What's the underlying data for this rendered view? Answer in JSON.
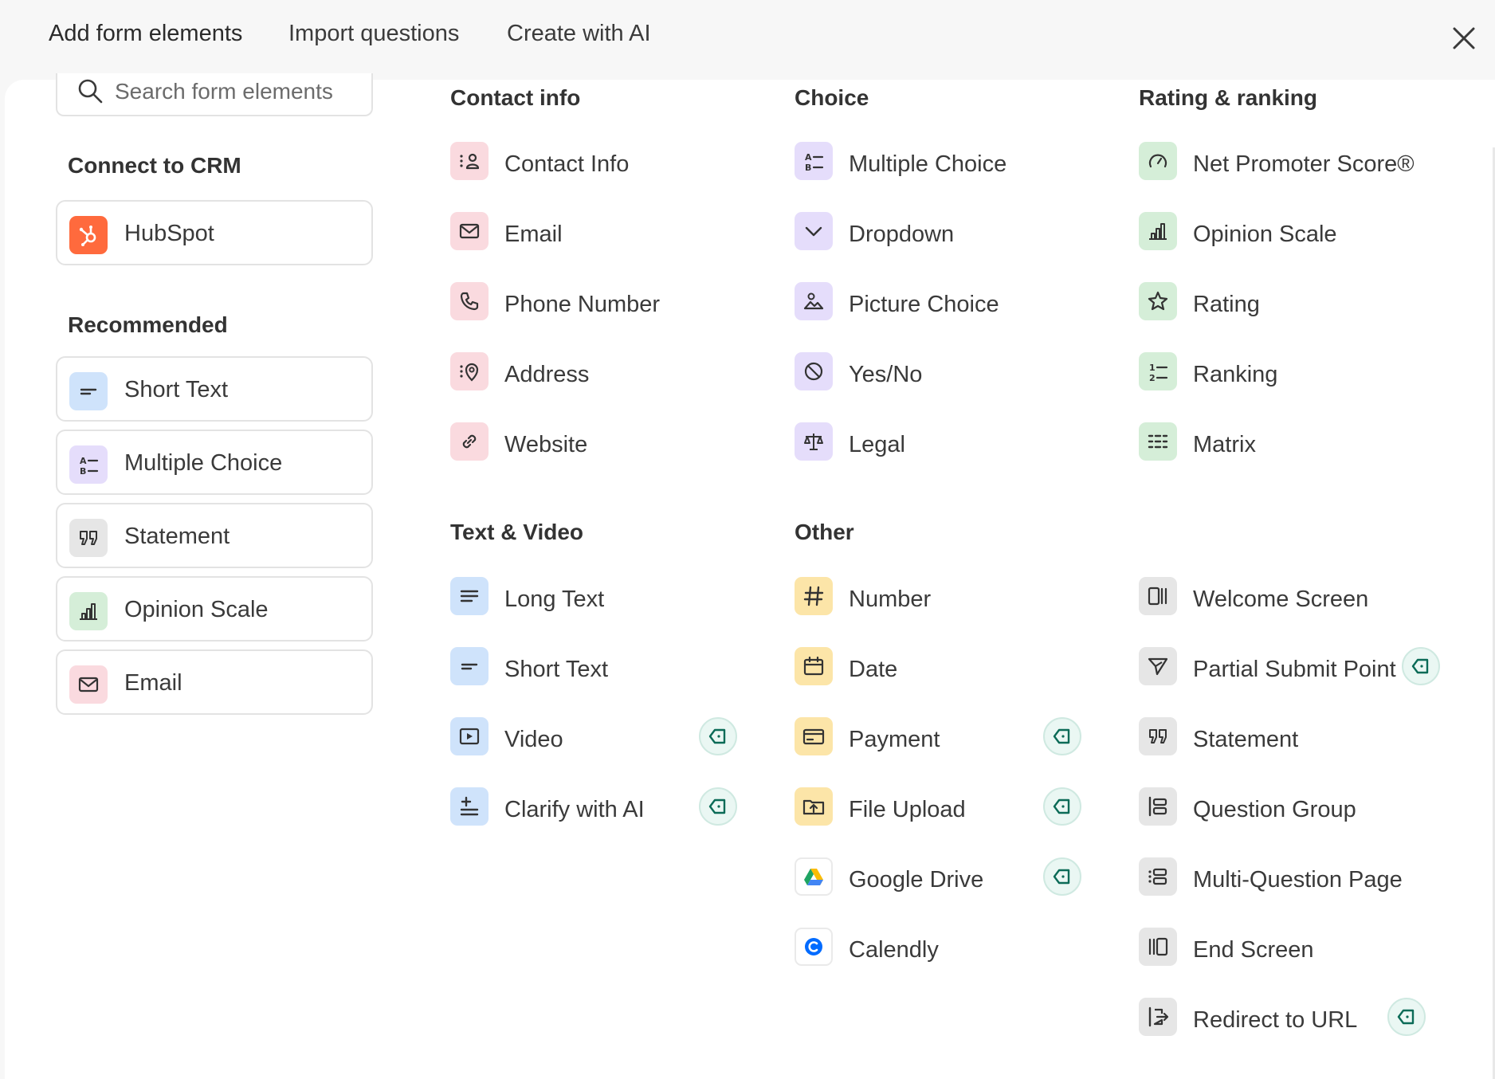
{
  "tabs": [
    {
      "label": "Add form elements"
    },
    {
      "label": "Import questions"
    },
    {
      "label": "Create with AI"
    }
  ],
  "search": {
    "placeholder": "Search form elements"
  },
  "sidebar": {
    "crm_title": "Connect to CRM",
    "crm_items": [
      {
        "label": "HubSpot",
        "icon": "hubspot-icon"
      }
    ],
    "recommended_title": "Recommended",
    "recommended_items": [
      {
        "label": "Short Text",
        "icon": "short-text-icon"
      },
      {
        "label": "Multiple Choice",
        "icon": "multiple-choice-icon"
      },
      {
        "label": "Statement",
        "icon": "quote-icon"
      },
      {
        "label": "Opinion Scale",
        "icon": "bar-chart-icon"
      },
      {
        "label": "Email",
        "icon": "envelope-icon"
      }
    ]
  },
  "sections": {
    "contact": {
      "title": "Contact info",
      "items": [
        {
          "label": "Contact Info"
        },
        {
          "label": "Email"
        },
        {
          "label": "Phone Number"
        },
        {
          "label": "Address"
        },
        {
          "label": "Website"
        }
      ]
    },
    "choice": {
      "title": "Choice",
      "items": [
        {
          "label": "Multiple Choice"
        },
        {
          "label": "Dropdown"
        },
        {
          "label": "Picture Choice"
        },
        {
          "label": "Yes/No"
        },
        {
          "label": "Legal"
        }
      ]
    },
    "rating": {
      "title": "Rating & ranking",
      "items": [
        {
          "label": "Net Promoter Score®"
        },
        {
          "label": "Opinion Scale"
        },
        {
          "label": "Rating"
        },
        {
          "label": "Ranking"
        },
        {
          "label": "Matrix"
        }
      ]
    },
    "text_video": {
      "title": "Text & Video",
      "items": [
        {
          "label": "Long Text"
        },
        {
          "label": "Short Text"
        },
        {
          "label": "Video",
          "premium": true
        },
        {
          "label": "Clarify with AI",
          "premium": true
        }
      ]
    },
    "other": {
      "title": "Other",
      "items": [
        {
          "label": "Number"
        },
        {
          "label": "Date"
        },
        {
          "label": "Payment",
          "premium": true
        },
        {
          "label": "File Upload",
          "premium": true
        },
        {
          "label": "Google Drive",
          "premium": true
        },
        {
          "label": "Calendly"
        }
      ]
    },
    "screens": {
      "items": [
        {
          "label": "Welcome Screen"
        },
        {
          "label": "Partial Submit Point",
          "premium": true
        },
        {
          "label": "Statement"
        },
        {
          "label": "Question Group"
        },
        {
          "label": "Multi-Question Page"
        },
        {
          "label": "End Screen"
        },
        {
          "label": "Redirect to URL",
          "premium": true
        }
      ]
    }
  },
  "colors": {
    "contact": "#fadadf",
    "choice": "#e5ddfb",
    "rating": "#d5eed8",
    "text_video": "#cfe3fb",
    "other": "#fce5a8",
    "screens": "#e6e6e6",
    "premium_badge": "#0b6b57",
    "hubspot": "#ff6a3d"
  }
}
